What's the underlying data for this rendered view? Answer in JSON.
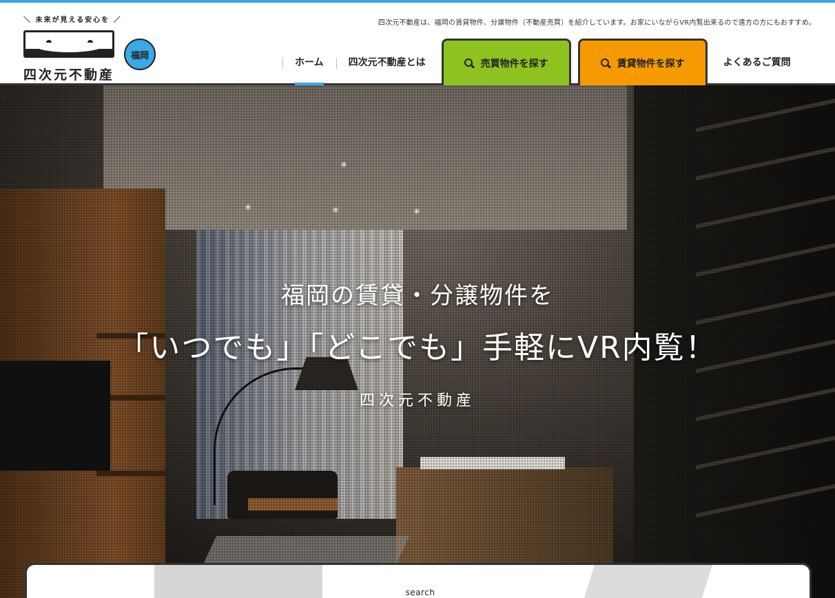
{
  "header": {
    "tagline": "四次元不動産は、福岡の賃貸物件、分譲物件（不動産売買）を紹介しています。お家にいながらVR内覧出来るので遠方の方にもおすすめ。",
    "logo": {
      "catch": "＼ 未来が見える安心を ／",
      "name": "四次元不動産",
      "badge": "福岡",
      "icon": "smiling-face-box-icon"
    },
    "nav": {
      "home": "ホーム",
      "about": "四次元不動産とは",
      "buy": "売買物件を探す",
      "rent": "賃貸物件を探す",
      "faq": "よくあるご質問"
    },
    "colors": {
      "accent": "#3aa9e6",
      "buy": "#8dc21f",
      "rent": "#f59a00",
      "border": "#333333"
    }
  },
  "hero": {
    "line1": "福岡の賃貸・分譲物件を",
    "line2": "「いつでも」「どこでも」手軽にVR内覧！",
    "line3": "四次元不動産"
  },
  "search": {
    "label": "search"
  }
}
